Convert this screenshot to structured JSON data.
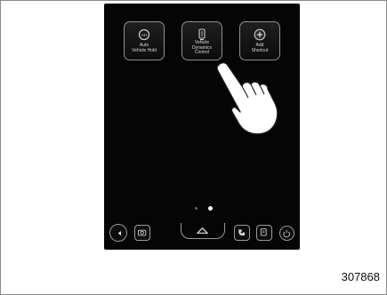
{
  "screen": {
    "tiles": [
      {
        "label": "Auto\nVehicle Hold",
        "icon": "auto-vehicle-hold-icon"
      },
      {
        "label": "Vehicle\nDynamics\nControl",
        "icon": "vehicle-dynamics-control-icon"
      },
      {
        "label": "Add\nShortcut",
        "icon": "add-shortcut-icon"
      }
    ],
    "page_indicator": {
      "count": 2,
      "active": 2
    }
  },
  "bottom_bar": {
    "items": [
      "audio-icon",
      "camera-icon",
      "home-icon",
      "phone-icon",
      "apps-icon",
      "power-icon"
    ]
  },
  "figure_code": "307868",
  "colors": {
    "screen_bg": "#050505",
    "tile_border": "#8f8f8f",
    "label": "#d8d8d8"
  }
}
